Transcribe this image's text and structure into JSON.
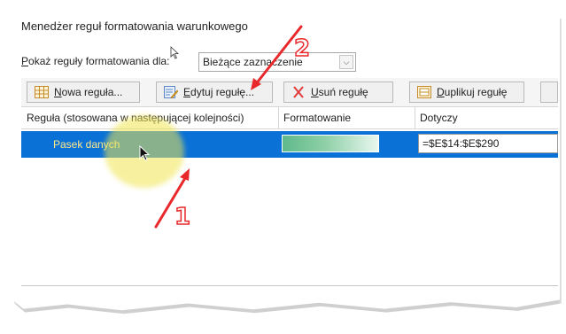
{
  "dialog": {
    "title": "Menedżer reguł formatowania warunkowego",
    "show_rules_label_underlined": "P",
    "show_rules_label_rest": "okaż reguły formatowania dla:",
    "scope_value": "Bieżące zaznaczenie"
  },
  "toolbar": {
    "new_rule_u": "N",
    "new_rule_rest": "owa reguła...",
    "edit_rule_u": "E",
    "edit_rule_rest": "dytuj regułę...",
    "delete_rule_u": "U",
    "delete_rule_rest": "suń regułę",
    "duplicate_rule_u": "D",
    "duplicate_rule_rest": "uplikuj regułę"
  },
  "grid": {
    "headers": [
      "Reguła (stosowana w następującej kolejności)",
      "Formatowanie",
      "Dotyczy"
    ],
    "rows": [
      {
        "name": "Pasek danych",
        "applies_to": "=$E$14:$E$290"
      }
    ]
  },
  "annotations": {
    "label_1": "1",
    "label_2": "2",
    "color": "#e8282b"
  },
  "colors": {
    "selection": "#0a71d6",
    "bar_start": "#5fb98a",
    "bar_end": "#e9f7ef",
    "highlight": "#f0e650"
  }
}
